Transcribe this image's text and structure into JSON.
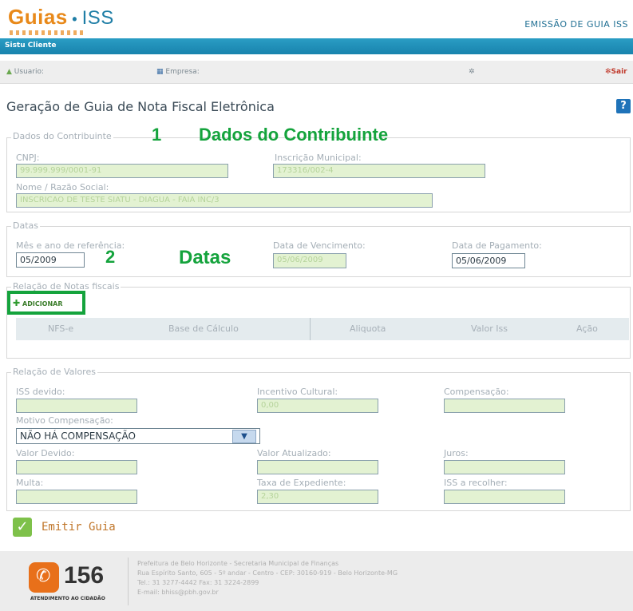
{
  "header": {
    "logo_text": "Guias",
    "logo_sub": "ISS",
    "right_title": "EMISSÃO DE GUIA ISS"
  },
  "bluebar": {
    "label": "Sistu Cliente"
  },
  "infobar": {
    "usuario": "Usuario:",
    "empresa": "Empresa:",
    "sair": "Sair"
  },
  "page": {
    "title": "Geração de Guia de Nota Fiscal Eletrônica",
    "help": "?"
  },
  "contribuinte": {
    "legend": "Dados do Contribuinte",
    "annotation_num": "1",
    "annotation": "Dados do Contribuinte",
    "cnpj_label": "CNPJ:",
    "cnpj_value": "99.999.999/0001-91",
    "inscricao_label": "Inscrição Municipal:",
    "inscricao_value": "173316/002-4",
    "nome_label": "Nome / Razão Social:",
    "nome_value": "INSCRICAO DE TESTE SIATU - DIAGUA - FAIA INC/3"
  },
  "datas": {
    "legend": "Datas",
    "annotation_num": "2",
    "annotation": "Datas",
    "mes_label": "Mês e ano de referência:",
    "mes_value": "05/2009",
    "venc_label": "Data de Vencimento:",
    "venc_value": "05/06/2009",
    "pag_label": "Data de Pagamento:",
    "pag_value": "05/06/2009"
  },
  "notas": {
    "legend": "Relação de Notas fiscais",
    "add_label": "ADICIONAR",
    "columns": [
      "NFS-e",
      "Base de Cálculo",
      "Aliquota",
      "Valor Iss",
      "Ação"
    ]
  },
  "valores": {
    "legend": "Relação de Valores",
    "iss_devido_label": "ISS devido:",
    "incentivo_label": "Incentivo Cultural:",
    "incentivo_value": "0,00",
    "compensacao_label": "Compensação:",
    "motivo_label": "Motivo Compensação:",
    "motivo_value": "NÃO HÁ COMPENSAÇÃO",
    "valor_devido_label": "Valor Devido:",
    "valor_atualizado_label": "Valor Atualizado:",
    "juros_label": "Juros:",
    "multa_label": "Multa:",
    "taxa_label": "Taxa de Expediente:",
    "taxa_value": "2,30",
    "iss_recolher_label": "ISS a recolher:"
  },
  "actions": {
    "emitir_label": "Emitir Guia"
  },
  "footer": {
    "phone": "156",
    "phone_caption": "ATENDIMENTO AO CIDADÃO",
    "line1": "Prefeitura de Belo Horizonte - Secretaria Municipal de Finanças",
    "line2": "Rua Espírito Santo, 605 - 5º andar - Centro - CEP: 30160-919 - Belo Horizonte-MG",
    "line3": "Tel.: 31 3277-4442 Fax: 31 3224-2899",
    "line4": "E-mail: bhiss@pbh.gov.br"
  }
}
